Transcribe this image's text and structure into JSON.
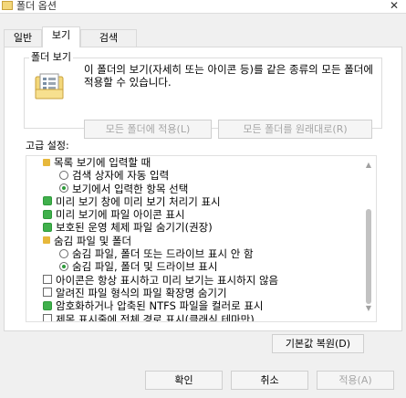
{
  "window": {
    "title": "폴더 옵션",
    "close_glyph": "✕"
  },
  "tabs": [
    {
      "label": "일반",
      "selected": false
    },
    {
      "label": "보기",
      "selected": true
    },
    {
      "label": "검색",
      "selected": false
    }
  ],
  "folder_views": {
    "group_label": "폴더 보기",
    "description": "이 폴더의 보기(자세히 또는 아이콘 등)를 같은 종류의 모든 폴더에 적용할 수 있습니다.",
    "apply_button": "모든 폴더에 적용(L)",
    "reset_button": "모든 폴더를 원래대로(R)"
  },
  "advanced": {
    "label": "고급 설정:",
    "items": [
      {
        "type": "folder",
        "level": 0,
        "label": "목록 보기에 입력할 때",
        "checked": false
      },
      {
        "type": "radio",
        "level": 1,
        "label": "검색 상자에 자동 입력",
        "checked": false
      },
      {
        "type": "radio",
        "level": 1,
        "label": "보기에서 입력한 항목 선택",
        "checked": true
      },
      {
        "type": "checkbox",
        "level": 0,
        "label": "미리 보기 창에 미리 보기 처리기 표시",
        "checked": true
      },
      {
        "type": "checkbox",
        "level": 0,
        "label": "미리 보기에 파일 아이콘 표시",
        "checked": true
      },
      {
        "type": "checkbox",
        "level": 0,
        "label": "보호된 운영 체제 파일 숨기기(권장)",
        "checked": true
      },
      {
        "type": "folder",
        "level": 0,
        "label": "숨김 파일 및 폴더",
        "checked": false
      },
      {
        "type": "radio",
        "level": 1,
        "label": "숨김 파일, 폴더 또는 드라이브 표시 안 함",
        "checked": false
      },
      {
        "type": "radio",
        "level": 1,
        "label": "숨김 파일, 폴더 및 드라이브 표시",
        "checked": true
      },
      {
        "type": "checkbox",
        "level": 0,
        "label": "아이콘은 항상 표시하고 미리 보기는 표시하지 않음",
        "checked": false
      },
      {
        "type": "checkbox",
        "level": 0,
        "label": "알려진 파일 형식의 파일 확장명 숨기기",
        "checked": false
      },
      {
        "type": "checkbox",
        "level": 0,
        "label": "암호화하거나 압축된 NTFS 파일을 컬러로 표시",
        "checked": true
      },
      {
        "type": "checkbox",
        "level": 0,
        "label": "제목 표시줄에 전체 경로 표시(클래식 테마만)",
        "checked": false
      }
    ],
    "scroll_up_glyph": "▲",
    "scroll_down_glyph": "▼",
    "restore_button": "기본값 복원(D)"
  },
  "footer": {
    "ok": "확인",
    "cancel": "취소",
    "apply": "적용(A)"
  },
  "colors": {
    "accent_check": "#40b04c",
    "folder_icon": "#e7b83b",
    "disabled_text": "#a6a6a6"
  }
}
